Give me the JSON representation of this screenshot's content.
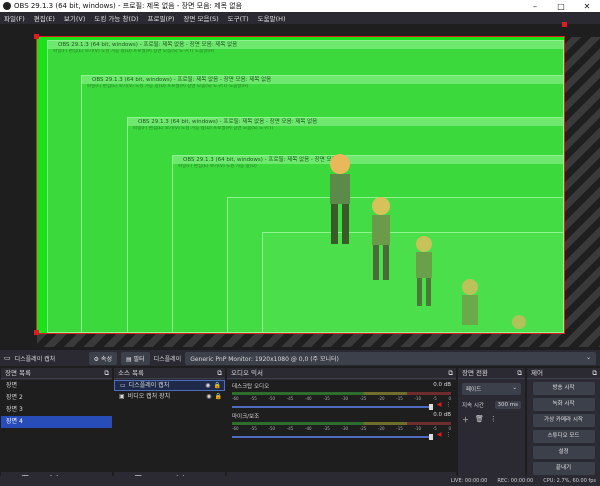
{
  "window": {
    "title": "OBS 29.1.3 (64 bit, windows) - 프로필: 제목 없음 - 장면 모음: 제목 없음",
    "minimize": "–",
    "maximize": "□",
    "close": "✕"
  },
  "menu": [
    "파일(F)",
    "편집(E)",
    "보기(V)",
    "도킹 가능 창(D)",
    "프로필(P)",
    "장면 모음(S)",
    "도구(T)",
    "도움말(H)"
  ],
  "nested": [
    {
      "title": "OBS 29.1.3 (64 bit, windows) - 프로필: 제목 없음 - 장면 모음: 제목 없음",
      "menu": "파일(F)  편집(E)  보기(V)  도킹 가능 창(D)  프로필(P)  장면 모음(S)  도구(T)  도움말(H)"
    },
    {
      "title": "OBS 29.1.3 (64 bit, windows) - 프로필: 제목 없음 - 장면 모음: 제목 없음",
      "menu": "파일(F)  편집(E)  보기(V)  도킹 가능 창(D)  프로필(P)  장면 모음(S)  도구(T)  도움말(H)"
    },
    {
      "title": "OBS 29.1.3 (64 bit, windows) - 프로필: 제목 없음 - 장면 모음: 제목 없음",
      "menu": "파일(F)  편집(E)  보기(V)  도킹 가능 창(D)  프로필(P)  장면 모음(S)  도구(T)"
    },
    {
      "title": "OBS 29.1.3 (64 bit, windows) - 프로필: 제목 없음 - 장면 모음",
      "menu": "파일(F)  편집(E)  보기(V)  도킹 가능 창(D)"
    }
  ],
  "source_toolbar": {
    "source_label": "디스플레이 캡처",
    "properties": "속성",
    "filters": "필터",
    "display_label": "디스플레이",
    "display_value": "Generic PnP Monitor: 1920x1080 @ 0,0 (주 모니터)"
  },
  "scenes": {
    "header": "장면 목록",
    "items": [
      "장면",
      "장면 2",
      "장면 3",
      "장면 4"
    ],
    "active_index": 3
  },
  "sources": {
    "header": "소스 목록",
    "items": [
      "디스플레이 캡처",
      "비디오 캡처 장치"
    ]
  },
  "mixer": {
    "header": "오디오 믹서",
    "tracks": [
      {
        "name": "데스크탑 오디오",
        "db": "0.0 dB"
      },
      {
        "name": "마이크/보조",
        "db": "0.0 dB"
      }
    ],
    "scale": [
      "-60",
      "-55",
      "-50",
      "-45",
      "-40",
      "-35",
      "-30",
      "-25",
      "-20",
      "-15",
      "-10",
      "-5",
      "0"
    ]
  },
  "transitions": {
    "header": "장면 전환",
    "type": "페이드",
    "duration_label": "지속 시간",
    "duration_value": "300 ms"
  },
  "controls": {
    "header": "제어",
    "buttons": [
      "방송 시작",
      "녹화 시작",
      "가상 카메라 시작",
      "스튜디오 모드",
      "설정",
      "끝내기"
    ]
  },
  "status": {
    "live": "LIVE: 00:00:00",
    "rec": "REC: 00:00:00",
    "cpu": "CPU: 2.7%, 60.00 fps"
  },
  "colors": {
    "green_canvas": "#1be11b",
    "accent_blue": "#284cb8",
    "red_bounds": "#e01b24"
  }
}
